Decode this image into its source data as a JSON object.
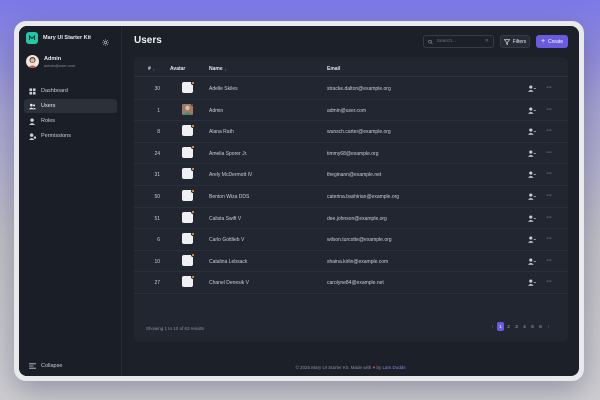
{
  "app": {
    "title": "Mary UI Starter Kit"
  },
  "user": {
    "name": "Admin",
    "email": "admin@user.com"
  },
  "sidebar": {
    "items": [
      {
        "label": "Dashboard",
        "icon": "dashboard-icon",
        "active": false
      },
      {
        "label": "Users",
        "icon": "users-icon",
        "active": true
      },
      {
        "label": "Roles",
        "icon": "roles-icon",
        "active": false
      },
      {
        "label": "Permissions",
        "icon": "permissions-icon",
        "active": false
      }
    ],
    "collapse_label": "Collapse"
  },
  "header": {
    "title": "Users",
    "search_placeholder": "Search...",
    "filters_label": "Filters",
    "create_label": "Create"
  },
  "table": {
    "columns": {
      "id": "#",
      "avatar": "Avatar",
      "name": "Name",
      "email": "Email"
    },
    "rows": [
      {
        "id": "30",
        "name": "Adelle Skiles",
        "email": "stracke.dalton@example.org",
        "avatar": "placeholder"
      },
      {
        "id": "1",
        "name": "Admin",
        "email": "admin@user.com",
        "avatar": "photo"
      },
      {
        "id": "8",
        "name": "Alana Rath",
        "email": "wunsch.carter@example.org",
        "avatar": "placeholder"
      },
      {
        "id": "24",
        "name": "Amelia Sporer Jr.",
        "email": "timmy68@example.org",
        "avatar": "placeholder"
      },
      {
        "id": "31",
        "name": "Arely McDermott IV",
        "email": "theginann@example.net",
        "avatar": "placeholder"
      },
      {
        "id": "50",
        "name": "Benton Wiza DDS",
        "email": "caterina.bashirian@example.org",
        "avatar": "placeholder"
      },
      {
        "id": "51",
        "name": "Calista Swift V",
        "email": "dee.johnson@example.org",
        "avatar": "placeholder"
      },
      {
        "id": "6",
        "name": "Carlo Gottlieb V",
        "email": "wilson.turcotte@example.org",
        "avatar": "placeholder"
      },
      {
        "id": "10",
        "name": "Catalina Lebsack",
        "email": "shaina.kirlin@example.com",
        "avatar": "placeholder"
      },
      {
        "id": "27",
        "name": "Chanel Denesik V",
        "email": "carolyne84@example.net",
        "avatar": "placeholder"
      }
    ],
    "summary": "Showing 1 to 10 of 63 results"
  },
  "pagination": {
    "prev": "‹",
    "pages": [
      "1",
      "2",
      "3",
      "4",
      "5",
      "6"
    ],
    "current": "1",
    "next": "›"
  },
  "footer": {
    "prefix": "© 2025 Mary UI Starter Kit. Made with",
    "heart": "♥",
    "by": "by",
    "author": "Lars Dodds"
  },
  "colors": {
    "accent": "#6a5ae0",
    "brand": "#22c8a8",
    "status_dot": "#f2b233",
    "heart": "#e0484e"
  }
}
